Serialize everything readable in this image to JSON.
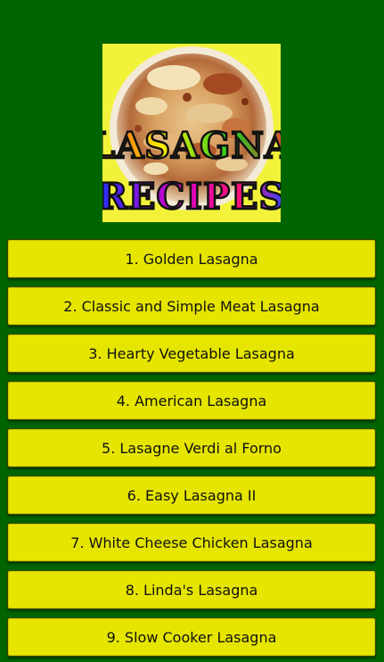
{
  "logo": {
    "line1": "LASAGNA",
    "line2": "RECIPES"
  },
  "recipes": [
    {
      "label": "1. Golden Lasagna"
    },
    {
      "label": "2. Classic and Simple Meat Lasagna"
    },
    {
      "label": "3. Hearty Vegetable Lasagna"
    },
    {
      "label": "4. American Lasagna"
    },
    {
      "label": "5. Lasagne Verdi al Forno"
    },
    {
      "label": "6. Easy Lasagna II"
    },
    {
      "label": "7. White Cheese Chicken Lasagna"
    },
    {
      "label": "8. Linda's Lasagna"
    },
    {
      "label": "9. Slow Cooker Lasagna"
    }
  ],
  "colors": {
    "background": "#006400",
    "button": "#e5e500",
    "logo_background": "#f2f23a"
  }
}
